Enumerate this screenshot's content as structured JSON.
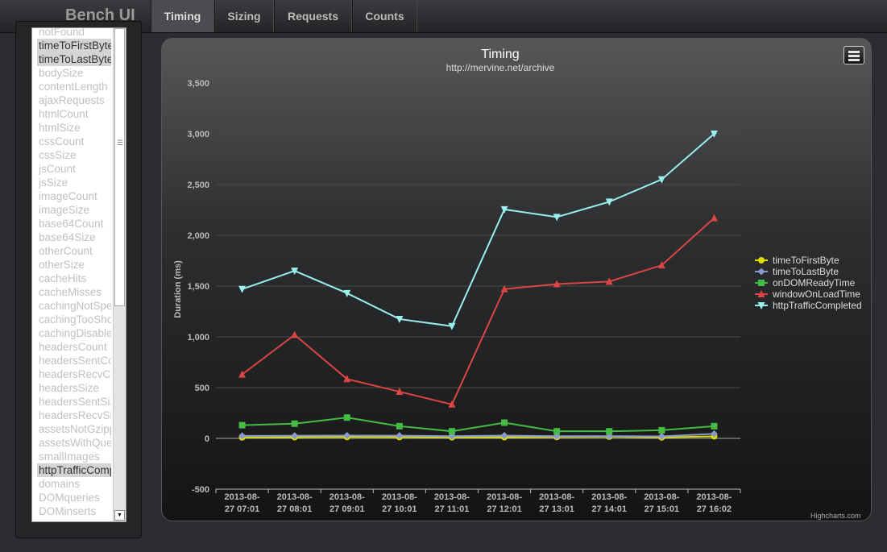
{
  "navbar": {
    "brand": "Bench UI",
    "tabs": [
      {
        "label": "Timing",
        "active": true
      },
      {
        "label": "Sizing",
        "active": false
      },
      {
        "label": "Requests",
        "active": false
      },
      {
        "label": "Counts",
        "active": false
      }
    ]
  },
  "metric_list": {
    "items": [
      {
        "label": "notFound",
        "selected": false
      },
      {
        "label": "timeToFirstByte",
        "selected": true
      },
      {
        "label": "timeToLastByte",
        "selected": true
      },
      {
        "label": "bodySize",
        "selected": false
      },
      {
        "label": "contentLength",
        "selected": false
      },
      {
        "label": "ajaxRequests",
        "selected": false
      },
      {
        "label": "htmlCount",
        "selected": false
      },
      {
        "label": "htmlSize",
        "selected": false
      },
      {
        "label": "cssCount",
        "selected": false
      },
      {
        "label": "cssSize",
        "selected": false
      },
      {
        "label": "jsCount",
        "selected": false
      },
      {
        "label": "jsSize",
        "selected": false
      },
      {
        "label": "imageCount",
        "selected": false
      },
      {
        "label": "imageSize",
        "selected": false
      },
      {
        "label": "base64Count",
        "selected": false
      },
      {
        "label": "base64Size",
        "selected": false
      },
      {
        "label": "otherCount",
        "selected": false
      },
      {
        "label": "otherSize",
        "selected": false
      },
      {
        "label": "cacheHits",
        "selected": false
      },
      {
        "label": "cacheMisses",
        "selected": false
      },
      {
        "label": "cachingNotSpecified",
        "selected": false
      },
      {
        "label": "cachingTooShort",
        "selected": false
      },
      {
        "label": "cachingDisabled",
        "selected": false
      },
      {
        "label": "headersCount",
        "selected": false
      },
      {
        "label": "headersSentCount",
        "selected": false
      },
      {
        "label": "headersRecvCount",
        "selected": false
      },
      {
        "label": "headersSize",
        "selected": false
      },
      {
        "label": "headersSentSize",
        "selected": false
      },
      {
        "label": "headersRecvSize",
        "selected": false
      },
      {
        "label": "assetsNotGzipped",
        "selected": false
      },
      {
        "label": "assetsWithQueryString",
        "selected": false
      },
      {
        "label": "smallImages",
        "selected": false
      },
      {
        "label": "httpTrafficCompleted",
        "selected": true
      },
      {
        "label": "domains",
        "selected": false
      },
      {
        "label": "DOMqueries",
        "selected": false
      },
      {
        "label": "DOMinserts",
        "selected": false
      }
    ]
  },
  "chart_data": {
    "type": "line",
    "title": "Timing",
    "subtitle": "http://mervine.net/archive",
    "ylabel": "Duration (ms)",
    "xlabel": "",
    "ylim": [
      -500,
      3500
    ],
    "yticks": [
      -500,
      0,
      500,
      1000,
      1500,
      2000,
      2500,
      3000,
      3500
    ],
    "ytick_labels": [
      "-500",
      "0",
      "500",
      "1,000",
      "1,500",
      "2,000",
      "2,500",
      "3,000",
      "3,500"
    ],
    "categories": [
      [
        "2013-08-",
        "27 07:01"
      ],
      [
        "2013-08-",
        "27 08:01"
      ],
      [
        "2013-08-",
        "27 09:01"
      ],
      [
        "2013-08-",
        "27 10:01"
      ],
      [
        "2013-08-",
        "27 11:01"
      ],
      [
        "2013-08-",
        "27 12:01"
      ],
      [
        "2013-08-",
        "27 13:01"
      ],
      [
        "2013-08-",
        "27 14:01"
      ],
      [
        "2013-08-",
        "27 15:01"
      ],
      [
        "2013-08-",
        "27 16:02"
      ]
    ],
    "grid": true,
    "legend_position": "right",
    "series": [
      {
        "name": "timeToFirstByte",
        "color": "#dddd00",
        "marker": "circle",
        "values": [
          10,
          12,
          14,
          13,
          11,
          12,
          14,
          16,
          10,
          20
        ]
      },
      {
        "name": "timeToLastByte",
        "color": "#8899cc",
        "marker": "diamond",
        "values": [
          25,
          26,
          28,
          27,
          22,
          28,
          22,
          22,
          20,
          45
        ]
      },
      {
        "name": "onDOMReadyTime",
        "color": "#44bb44",
        "marker": "square",
        "values": [
          130,
          145,
          205,
          120,
          70,
          155,
          70,
          70,
          80,
          120
        ]
      },
      {
        "name": "windowOnLoadTime",
        "color": "#dd4444",
        "marker": "triangle",
        "values": [
          630,
          1020,
          585,
          460,
          335,
          1470,
          1520,
          1545,
          1705,
          2170
        ]
      },
      {
        "name": "httpTrafficCompleted",
        "color": "#99eeee",
        "marker": "triangle-down",
        "values": [
          1470,
          1650,
          1430,
          1175,
          1105,
          2255,
          2180,
          2330,
          2550,
          3000
        ]
      }
    ]
  },
  "credit": "Highcharts.com"
}
